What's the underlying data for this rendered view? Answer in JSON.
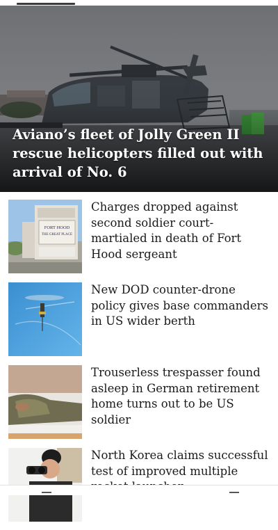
{
  "hero": {
    "title": "Aviano’s fleet of Jolly Green II rescue helicopters filled out with arrival of No. 6"
  },
  "articles": [
    {
      "title": "Charges dropped against second soldier court-martialed in death of Fort Hood sergeant",
      "thumb_sign_lines": [
        "FORT HOOD",
        "THE GREAT PLACE"
      ]
    },
    {
      "title": "New DOD counter-drone policy gives base commanders in US wider berth"
    },
    {
      "title": "Trouserless trespasser found asleep in German retirement home turns out to be US soldier"
    },
    {
      "title": "North Korea claims successful test of improved multiple rocket launcher"
    }
  ]
}
